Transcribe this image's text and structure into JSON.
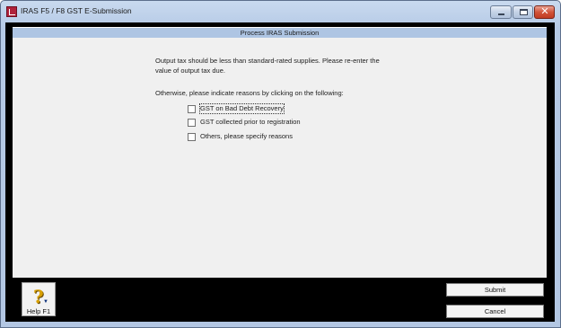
{
  "window": {
    "title": "IRAS F5 / F8 GST E-Submission",
    "icon": "iras-app-icon"
  },
  "header": {
    "title": "Process IRAS Submission"
  },
  "main": {
    "message_line1": "Output tax should be less than standard-rated supplies. Please re-enter the",
    "message_line2": "value of output tax due.",
    "instruction": "Otherwise, please indicate reasons by clicking on the following:",
    "reasons": [
      {
        "label": "GST on Bad Debt Recovery",
        "checked": false,
        "focused": true
      },
      {
        "label": "GST collected prior to registration",
        "checked": false,
        "focused": false
      },
      {
        "label": "Others, please specify reasons",
        "checked": false,
        "focused": false
      }
    ]
  },
  "footer": {
    "help_label": "Help F1",
    "submit_label": "Submit",
    "cancel_label": "Cancel"
  },
  "colors": {
    "header_bar": "#aec5e3",
    "frame": "#000000",
    "content_bg": "#f0f0f0"
  }
}
